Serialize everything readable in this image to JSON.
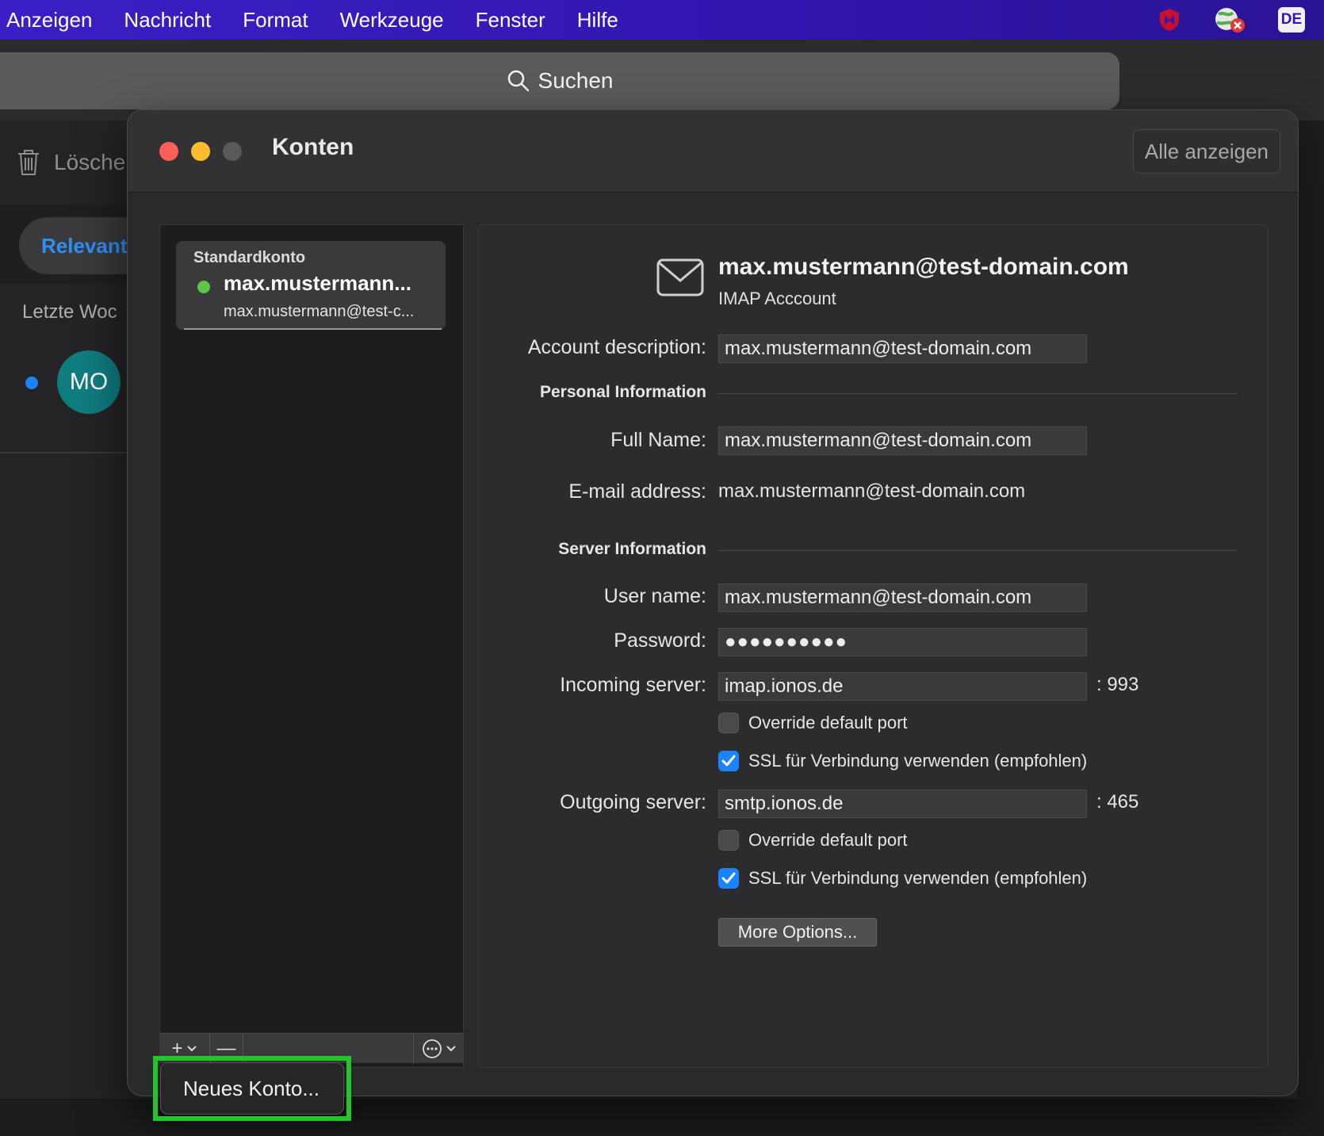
{
  "menubar": {
    "items": [
      "Anzeigen",
      "Nachricht",
      "Format",
      "Werkzeuge",
      "Fenster",
      "Hilfe"
    ],
    "tray": {
      "shield_icon": "mcafee-shield-icon",
      "globe_icon": "globe-error-icon",
      "input_source": "DE"
    }
  },
  "search": {
    "label": "Suchen"
  },
  "background": {
    "delete_label": "Lösche",
    "filter_label": "Relevant",
    "week_label": "Letzte Woc",
    "avatar_initials": "MO"
  },
  "dialog": {
    "title": "Konten",
    "show_all": "Alle anzeigen",
    "account": {
      "kind": "Standardkonto",
      "name": "max.mustermann...",
      "email": "max.mustermann@test-c...",
      "status_color": "#5fc44a"
    },
    "toolbar": {
      "add": "+",
      "remove": "—",
      "more": "⋯"
    },
    "detail": {
      "title": "max.mustermann@test-domain.com",
      "subtitle": "IMAP Acccount",
      "account_description": {
        "label": "Account description:",
        "value": "max.mustermann@test-domain.com"
      },
      "personal_section": "Personal Information",
      "full_name": {
        "label": "Full Name:",
        "value": "max.mustermann@test-domain.com"
      },
      "email": {
        "label": "E-mail address:",
        "value": "max.mustermann@test-domain.com"
      },
      "server_section": "Server Information",
      "user_name": {
        "label": "User name:",
        "value": "max.mustermann@test-domain.com"
      },
      "password": {
        "label": "Password:",
        "value": "●●●●●●●●●●"
      },
      "incoming": {
        "label": "Incoming server:",
        "value": "imap.ionos.de",
        "port": ": 993",
        "override_label": "Override default port",
        "override_checked": false,
        "ssl_label": "SSL für Verbindung verwenden (empfohlen)",
        "ssl_checked": true
      },
      "outgoing": {
        "label": "Outgoing server:",
        "value": "smtp.ionos.de",
        "port": ": 465",
        "override_label": "Override default port",
        "override_checked": false,
        "ssl_label": "SSL für Verbindung verwenden (empfohlen)",
        "ssl_checked": true
      },
      "more_options": "More Options..."
    }
  },
  "popup": {
    "new_account": "Neues Konto..."
  },
  "colors": {
    "accent": "#1a84ff",
    "highlight": "#22c52a",
    "menubar": "#3316b0"
  }
}
